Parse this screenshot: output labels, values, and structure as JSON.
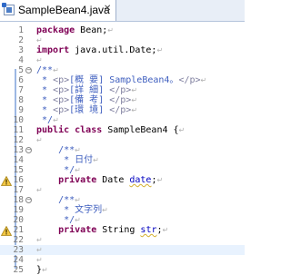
{
  "tab": {
    "title": "SampleBean4.java",
    "close": "✕"
  },
  "return_glyph": "↵",
  "lines": [
    {
      "num": "1",
      "tokens": [
        {
          "c": "kw",
          "t": "package"
        },
        {
          "c": "tx",
          "t": " Bean;"
        }
      ]
    },
    {
      "num": "2",
      "tokens": []
    },
    {
      "num": "3",
      "tokens": [
        {
          "c": "kw",
          "t": "import"
        },
        {
          "c": "tx",
          "t": " java.util.Date;"
        }
      ]
    },
    {
      "num": "4",
      "tokens": []
    },
    {
      "num": "5",
      "fold": "minus",
      "tokens": [
        {
          "c": "cm",
          "t": "/**"
        }
      ]
    },
    {
      "num": "6",
      "tokens": [
        {
          "c": "cm",
          "t": " * "
        },
        {
          "c": "tg",
          "t": "<p>"
        },
        {
          "c": "cm",
          "t": "[概 要] SampleBean4。"
        },
        {
          "c": "tg",
          "t": "</p>"
        }
      ]
    },
    {
      "num": "7",
      "tokens": [
        {
          "c": "cm",
          "t": " * "
        },
        {
          "c": "tg",
          "t": "<p>"
        },
        {
          "c": "cm",
          "t": "[詳 細] "
        },
        {
          "c": "tg",
          "t": "</p>"
        }
      ]
    },
    {
      "num": "8",
      "tokens": [
        {
          "c": "cm",
          "t": " * "
        },
        {
          "c": "tg",
          "t": "<p>"
        },
        {
          "c": "cm",
          "t": "[備 考] "
        },
        {
          "c": "tg",
          "t": "</p>"
        }
      ]
    },
    {
      "num": "9",
      "tokens": [
        {
          "c": "cm",
          "t": " * "
        },
        {
          "c": "tg",
          "t": "<p>"
        },
        {
          "c": "cm",
          "t": "[環 境] "
        },
        {
          "c": "tg",
          "t": "</p>"
        }
      ]
    },
    {
      "num": "10",
      "tokens": [
        {
          "c": "cm",
          "t": " */"
        }
      ]
    },
    {
      "num": "11",
      "tokens": [
        {
          "c": "kw",
          "t": "public class"
        },
        {
          "c": "tx",
          "t": " SampleBean4 {"
        }
      ]
    },
    {
      "num": "12",
      "tokens": []
    },
    {
      "num": "13",
      "fold": "minus",
      "tokens": [
        {
          "c": "cm",
          "t": "    /**"
        }
      ]
    },
    {
      "num": "14",
      "tokens": [
        {
          "c": "cm",
          "t": "     * 日付"
        }
      ]
    },
    {
      "num": "15",
      "tokens": [
        {
          "c": "cm",
          "t": "     */"
        }
      ]
    },
    {
      "num": "16",
      "warn": true,
      "tokens": [
        {
          "c": "tx",
          "t": "    "
        },
        {
          "c": "kw",
          "t": "private"
        },
        {
          "c": "tx",
          "t": " Date "
        },
        {
          "c": "fd",
          "t": "date",
          "u": true
        },
        {
          "c": "tx",
          "t": ";"
        }
      ]
    },
    {
      "num": "17",
      "tokens": []
    },
    {
      "num": "18",
      "fold": "minus",
      "tokens": [
        {
          "c": "cm",
          "t": "    /**"
        }
      ]
    },
    {
      "num": "19",
      "tokens": [
        {
          "c": "cm",
          "t": "     * 文字列"
        }
      ]
    },
    {
      "num": "20",
      "tokens": [
        {
          "c": "cm",
          "t": "     */"
        }
      ]
    },
    {
      "num": "21",
      "warn": true,
      "tokens": [
        {
          "c": "tx",
          "t": "    "
        },
        {
          "c": "kw",
          "t": "private"
        },
        {
          "c": "tx",
          "t": " String "
        },
        {
          "c": "fd",
          "t": "str",
          "u": true
        },
        {
          "c": "tx",
          "t": ";"
        }
      ]
    },
    {
      "num": "22",
      "tokens": []
    },
    {
      "num": "23",
      "current": true,
      "tokens": []
    },
    {
      "num": "24",
      "tokens": []
    },
    {
      "num": "25",
      "tokens": [
        {
          "c": "tx",
          "t": "}"
        }
      ]
    }
  ],
  "colors": {
    "keyword": "#7f0055",
    "comment": "#3f5fbf",
    "html_tag": "#7f7f9f",
    "field": "#0000c0",
    "current_line": "#e8f2fe",
    "change_bar": "#9db8e3"
  }
}
